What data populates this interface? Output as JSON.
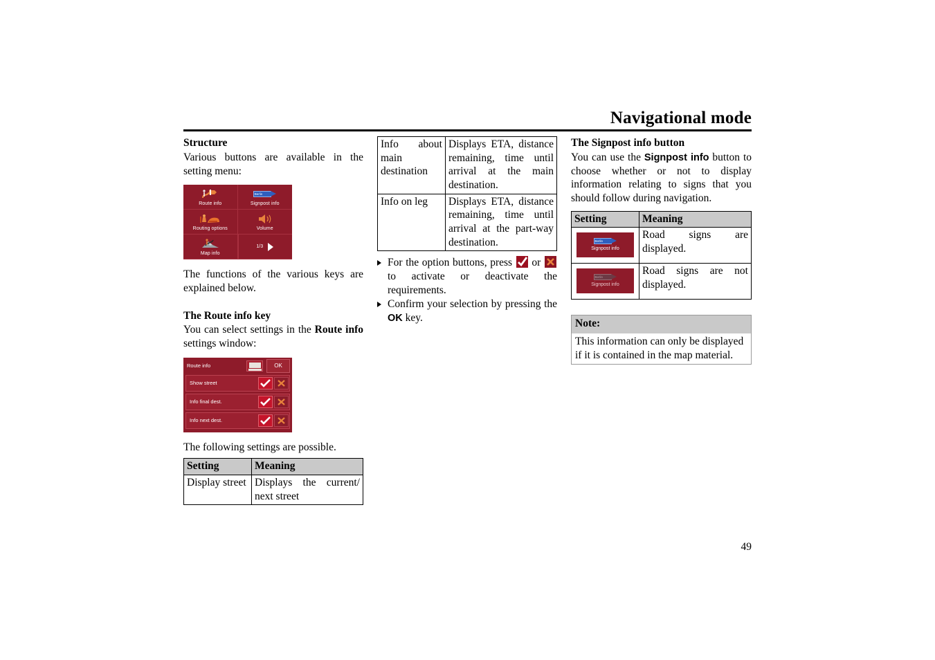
{
  "header": {
    "title": "Navigational mode"
  },
  "page_number": "49",
  "left_column": {
    "structure_heading": "Structure",
    "structure_text": "Various buttons are available in the setting menu:",
    "menu_screenshot": {
      "name": "setting-menu-screenshot",
      "cells": [
        {
          "label": "Route info",
          "icon": "route-info-icon"
        },
        {
          "label": "Signpost info",
          "icon": "signpost-info-icon",
          "sign_text": "Berlin"
        },
        {
          "label": "Routing options",
          "icon": "routing-options-icon"
        },
        {
          "label": "Volume",
          "icon": "volume-icon"
        },
        {
          "label": "Map info",
          "icon": "map-info-icon"
        },
        {
          "label": "",
          "icon": "next-page-arrow-icon",
          "page_indicator": "1/3"
        }
      ]
    },
    "after_menu_text": "The functions of the various keys are explained below.",
    "route_key_heading": "The Route info key",
    "route_key_text_a": "You can select settings in the ",
    "route_key_text_b": "Route info",
    "route_key_text_c": " settings window:",
    "route_window": {
      "name": "route-info-settings-window",
      "title": "Route info",
      "ok_label": "OK",
      "rows": [
        {
          "label": "Show street",
          "checked": true
        },
        {
          "label": "Info final dest.",
          "checked": true
        },
        {
          "label": "Info next dest.",
          "checked": true
        }
      ]
    },
    "following_settings_text": "The following settings are possible.",
    "settings_table": {
      "headers": [
        "Setting",
        "Meaning"
      ],
      "rows": [
        {
          "setting": "Display street",
          "meaning": "Displays the current/ next street"
        }
      ]
    }
  },
  "middle_column": {
    "info_table": {
      "rows": [
        {
          "setting": "Info about main destination",
          "meaning": "Displays ETA, distance remaining, time until arrival at the main destination."
        },
        {
          "setting": "Info on leg",
          "meaning": "Displays ETA, distance remaining, time until arrival at the part-way destination."
        }
      ]
    },
    "bullets": [
      {
        "text_a": "For the option buttons, press ",
        "icon_1": "checkmark-icon",
        "text_b": " or ",
        "icon_2": "cross-icon",
        "text_c": " to activate or deactivate the requirements."
      },
      {
        "text_a": "Confirm your selection by pressing the ",
        "bold": "OK",
        "text_c": " key."
      }
    ]
  },
  "right_column": {
    "signpost_heading": "The Signpost info button",
    "signpost_text_a": "You can use the ",
    "signpost_text_b": "Signpost info",
    "signpost_text_c": " button to choose whether or not to display information relating to signs that you should follow during navigation.",
    "signpost_table": {
      "headers": [
        "Setting",
        "Meaning"
      ],
      "rows": [
        {
          "button_label": "Signpost info",
          "button_state": "active",
          "sign_text": "Berlin",
          "meaning": "Road signs are displayed."
        },
        {
          "button_label": "Signpost info",
          "button_state": "inactive",
          "sign_text": "Berlin",
          "meaning": "Road signs are not displayed."
        }
      ]
    },
    "note": {
      "heading": "Note:",
      "body": "This information can only be displayed if it is contained in the map material."
    }
  },
  "colors": {
    "device_red": "#8e1b2a",
    "sign_blue": "#2f5fbe",
    "table_header_gray": "#c9c9c9",
    "check_red": "#c4142a",
    "cross_orange": "#e8823c"
  }
}
